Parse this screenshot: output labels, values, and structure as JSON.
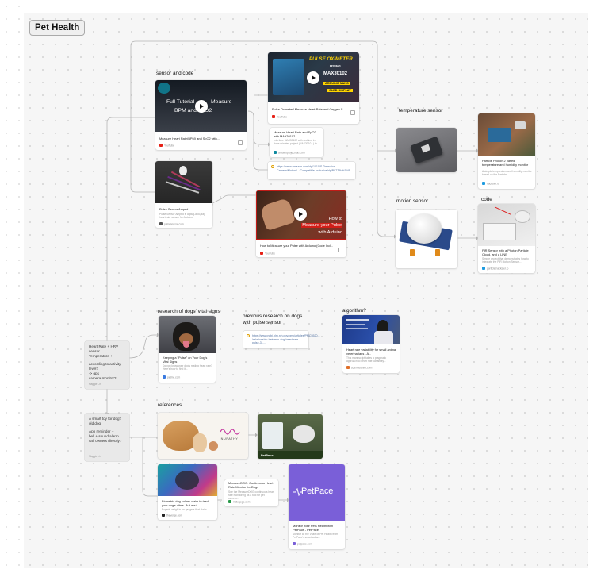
{
  "frame": {
    "title": "Pet Health"
  },
  "sections": {
    "sensor_and_code": "sensor and code",
    "temperature_sensor": "temperature sensor",
    "motion_sensor": "motion sensor",
    "code": "code",
    "research_vitals": "research of dogs' vital signs",
    "previous_research": "previous research on dogs\nwith pulse sensor",
    "algorithm": "algorithm?",
    "references": "references"
  },
  "cards": {
    "pulse_oximeter_video": {
      "title": "Pulse Oximeter! Measure Heart Rate and Oxygen S...",
      "source": "YouTube",
      "thumb_text": [
        "PULSE OXIMETER",
        "USING",
        "MAX30102",
        "ARDUINO NANO",
        "OLED DISPLAY"
      ]
    },
    "bpm_spo2_tutorial": {
      "title": "Measure Heart Rate(BPM) and SpO2 with...",
      "source": "YouTube",
      "thumb_text": [
        "Full Tutorial",
        "Measure",
        "BPM and SpO2"
      ]
    },
    "max30102_article": {
      "title": "Measure Heart Rate and SpO2 with MAX30102",
      "desc": "Interface MAX30102 with Arduino in three minutes project (MAX3010...) to ...",
      "source": "arduinoprojecthub.com"
    },
    "amazon_link": {
      "url": "https://www.amazon.com/dp/1010/S-Detection-Camera/Motion/.../Compatible-exclusive/dp/B07Z5HHJWS"
    },
    "pulse_sensor_amped": {
      "title": "Pulse Sensor Amped",
      "desc": "Pulse Sensor Amped is a plug-and-play heart-rate sensor for Arduino.",
      "source": "pulsesensor.com"
    },
    "measure_pulse_video": {
      "title": "How to Measure your Pulse with Arduino (Code Incl...",
      "source": "YouTube",
      "thumb_text": [
        "How to",
        "Measure your Pulse",
        "with Arduino"
      ]
    },
    "particle_photon": {
      "title": "Particle Photon 2 based temperature and humidity monitor",
      "desc": "A simple temperature and humidity monitor based on the Particle...",
      "source": "hackster.io"
    },
    "pir_sensor": {
      "title": "PIR Sensor with a Photon Particle Cloud, and a LINE",
      "desc": "Simple project that demonstrates how to integrate the PIR Motion Sensor...",
      "source": "particle.hackster.io"
    },
    "dog_pulse": {
      "title": "Keeping a \"Pulse\" on Your Dog's Vital Signs",
      "desc": "Do you know your dog's resting heart rate? Here's how to find it...",
      "source": "petmd.com"
    },
    "research_link": {
      "url": "https://www.ncbi.nlm.nih.gov/pmc/articles/PMC5520... /relationship-between-dog-heart-rate-pulse-31..."
    },
    "hrv_card": {
      "title": "Heart rate variability for small animal veterinarians - A...",
      "desc": "This manuscript takes a pragmatic approach to heart rate variability...",
      "source": "sciencedirect.com"
    },
    "inupathy": {
      "brand": "INUPATHY"
    },
    "petpace_photo": {
      "caption": "PetPace"
    },
    "biometric_collar": {
      "title": "Biometric dog collars claim to track your dog's vitals. But are t...",
      "desc": "Experts weigh in on gadgets that claim...",
      "source": "theverge.com"
    },
    "measuredog": {
      "title": "MeasureDOG: Continuous Heart Rate Monitor for Dogs",
      "desc": "See the MeasureDOG continuous heart rate monitoring as a tool for pet owners...",
      "source": "indiegogo.com"
    },
    "petpace_card": {
      "logo": "PetPace",
      "title": "Monitor Your Pets Health with PetPace - PetPace",
      "desc": "Monitor all the Vitals of Pet Health from PetPace's smart collar...",
      "source": "petpace.com"
    }
  },
  "notes": {
    "sensors_note": {
      "lines": [
        "Heart Rate + HRV sensor",
        "Temperature +",
        "",
        "according to activity level?",
        "-> gps",
        "camera monitor?"
      ],
      "owner": "Maggie Lin"
    },
    "alarm_note": {
      "lines": [
        "A smart toy for dog?",
        "old dog",
        "",
        "App reminder +",
        "bell + sound alarm",
        "call owners directly?"
      ],
      "owner": "Maggie Lin"
    }
  },
  "colors": {
    "accent": "#ffd400",
    "petpace_purple": "#7a5fd8",
    "connector": "#b4b4b4",
    "youtube_red": "#e62117"
  }
}
